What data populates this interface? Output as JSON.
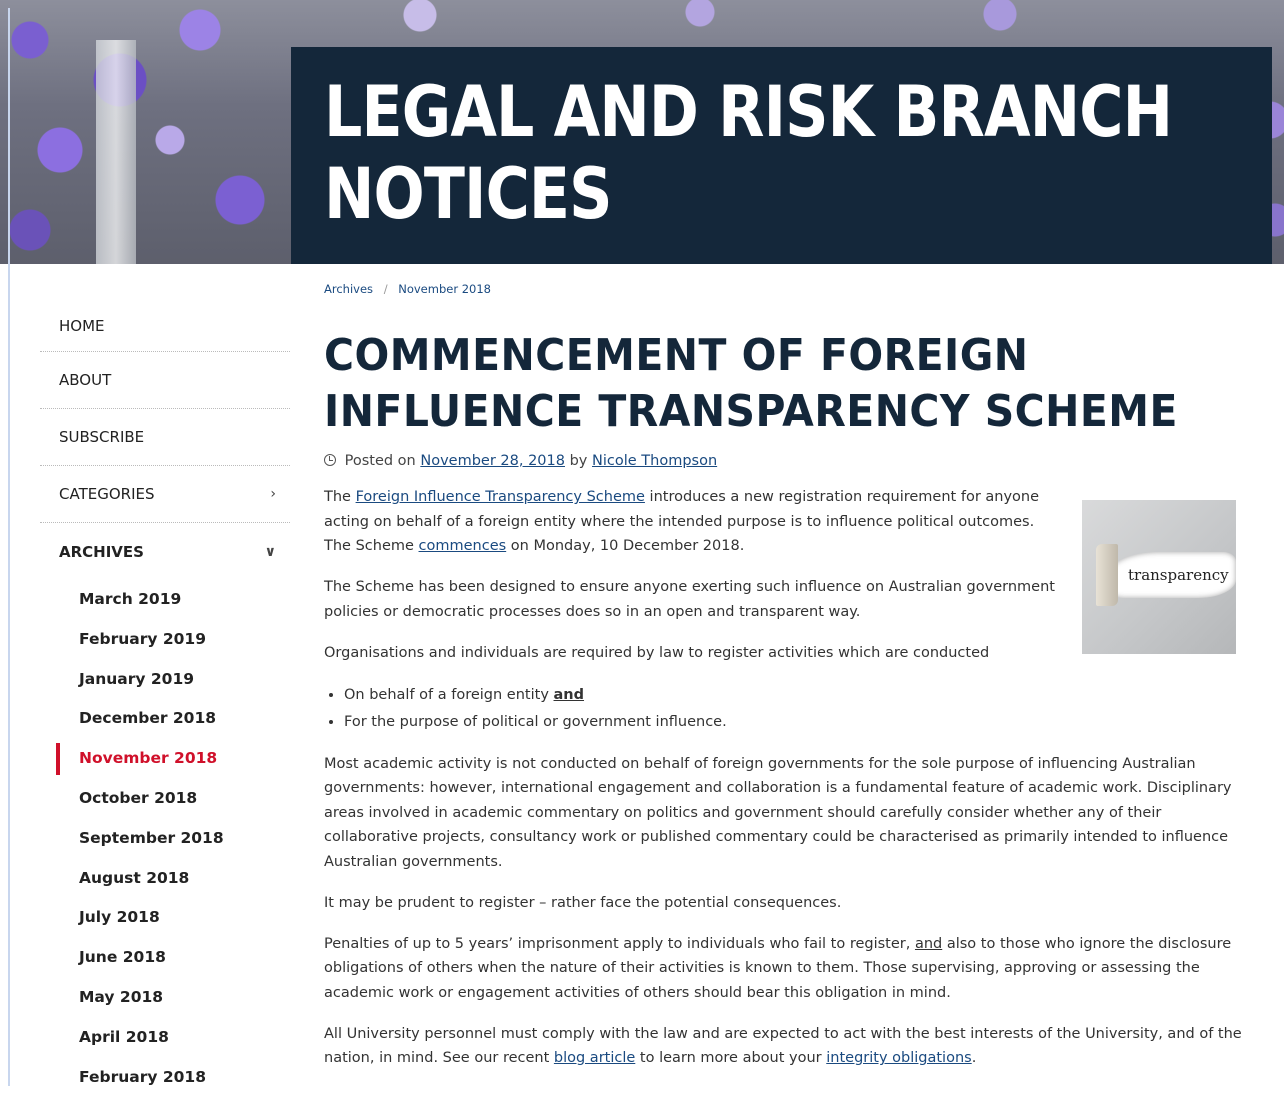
{
  "site": {
    "title_line1": "LEGAL AND RISK BRANCH",
    "title_line2": "NOTICES"
  },
  "sidebar": {
    "items": [
      {
        "label": "HOME"
      },
      {
        "label": "ABOUT"
      },
      {
        "label": "SUBSCRIBE"
      },
      {
        "label": "CATEGORIES",
        "icon": "chevron-right-icon"
      },
      {
        "label": "ARCHIVES",
        "icon": "chevron-down-icon"
      }
    ],
    "archives": [
      "March 2019",
      "February 2019",
      "January 2019",
      "December 2018",
      "November 2018",
      "October 2018",
      "September 2018",
      "August 2018",
      "July 2018",
      "June 2018",
      "May 2018",
      "April 2018",
      "February 2018"
    ],
    "active_archive": "November 2018",
    "active_color": "#d0102a"
  },
  "breadcrumb": {
    "items": [
      "Archives",
      "November 2018"
    ],
    "separator": "/"
  },
  "post": {
    "title_line1": "COMMENCEMENT OF FOREIGN",
    "title_line2": "INFLUENCE TRANSPARENCY SCHEME",
    "meta": {
      "prefix": "Posted on",
      "date": "November 28, 2018",
      "by": "by",
      "author": "Nicole Thompson"
    },
    "image_word": "transparency",
    "p1": {
      "pre": "The",
      "link": "Foreign Influence Transparency Scheme",
      "mid": "introduces a new registration requirement for anyone acting on behalf of a foreign entity where the intended purpose is to influence political outcomes. The Scheme",
      "link2": "commences",
      "post": "on Monday, 10 December 2018."
    },
    "p2": "The Scheme has been designed to ensure anyone exerting such influence on Australian government policies or democratic processes does so in an open and transparent way.",
    "p3": "Organisations and individuals are required by law to register activities which are conducted",
    "bullets": {
      "b1_text": "On behalf of a foreign entity",
      "b1_emph": "and",
      "b2_text": "For the purpose of political or government influence."
    },
    "p4": "Most academic activity is not conducted on behalf of foreign governments for the sole purpose of influencing Australian governments: however, international engagement and collaboration is a fundamental feature of academic work. Disciplinary areas involved in academic commentary on politics and government should carefully consider whether any of their collaborative projects, consultancy work or published commentary could be characterised as primarily intended to influence Australian governments.",
    "p5": "It may be prudent to register – rather face the potential consequences.",
    "p6": {
      "pre": "Penalties of up to 5 years’ imprisonment apply to individuals who fail to register,",
      "emph": "and",
      "post": "also to those who ignore the disclosure obligations of others when the nature of their activities is known to them. Those supervising, approving or assessing the academic work or engagement activities of others should bear this obligation in mind."
    },
    "p7": {
      "pre": "All University personnel must comply with the law and are expected to act with the best interests of the University, and of the nation, in mind. See our recent",
      "link": "blog article",
      "mid": "to learn more about your",
      "link2": "integrity obligations",
      "post": "."
    }
  },
  "colors": {
    "title_bg": "#14273a",
    "link": "#1a4a80"
  }
}
